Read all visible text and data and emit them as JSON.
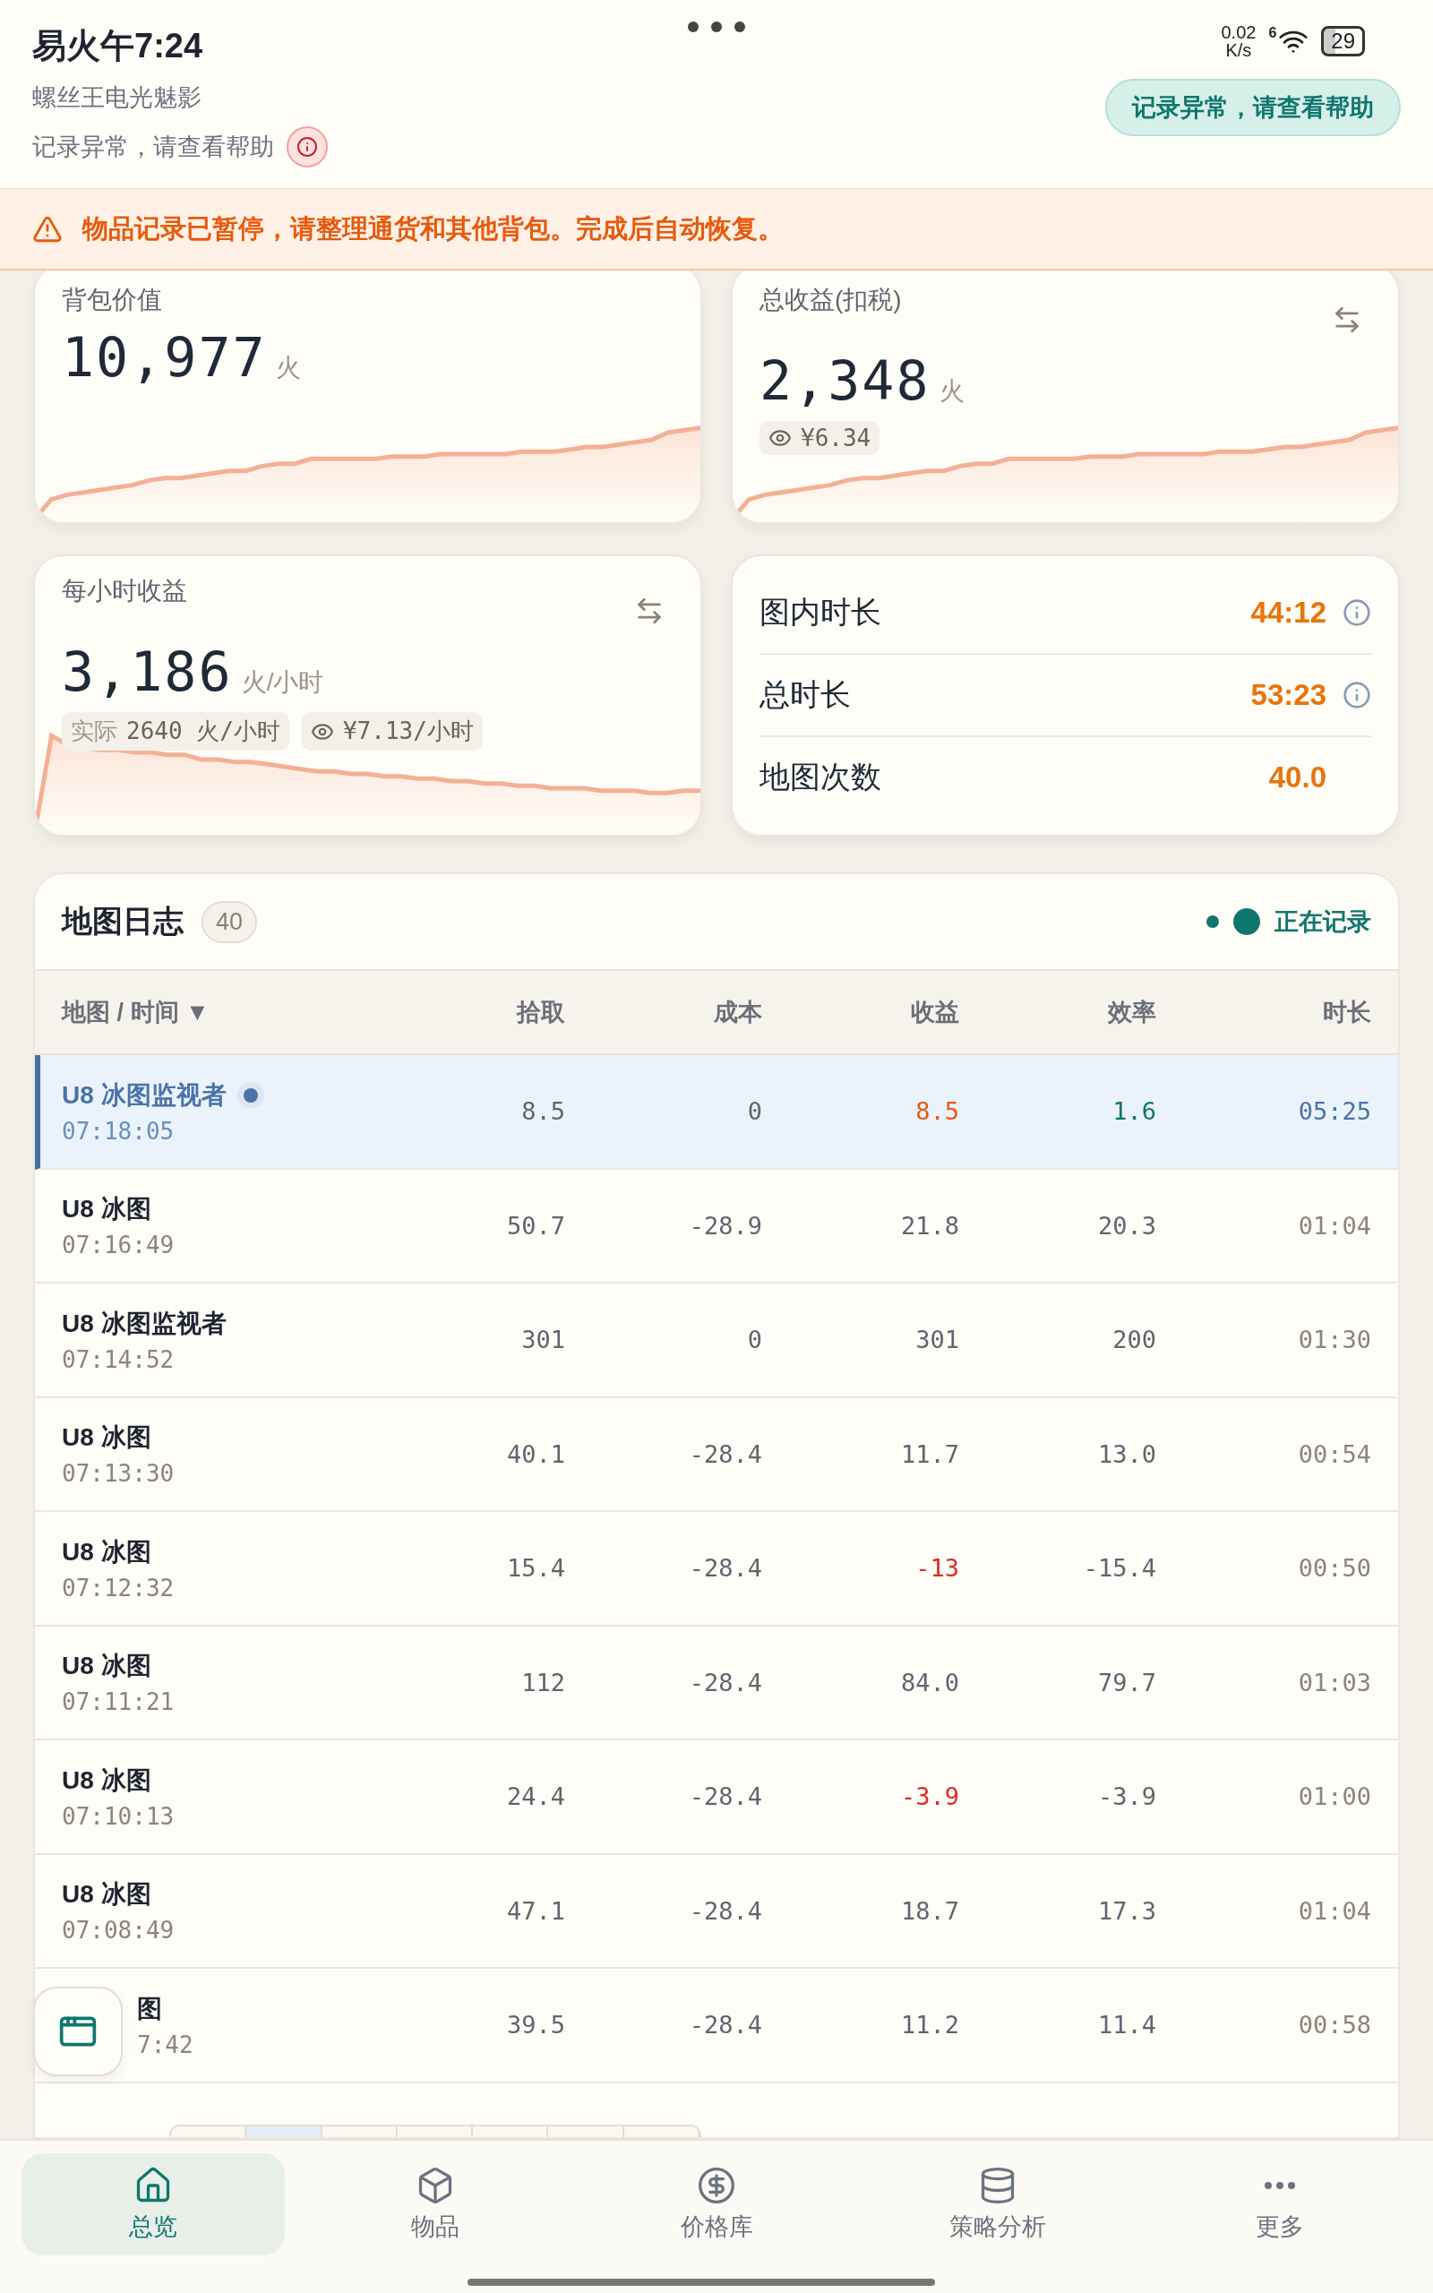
{
  "status_bar": {
    "time": "易火午7:24",
    "net_speed": "0.02",
    "net_unit": "K/s",
    "wifi_badge": "6",
    "battery": "29"
  },
  "header": {
    "subtitle": "螺丝王电光魅影",
    "warning": "记录异常，请查看帮助",
    "help_button": "记录异常，请查看帮助"
  },
  "banner": {
    "text": "物品记录已暂停，请整理通货和其他背包。完成后自动恢复。"
  },
  "cards": [
    {
      "kind": "value",
      "title": "背包价值",
      "value": "10,977",
      "unit": "火",
      "swap": false
    },
    {
      "kind": "value",
      "title": "总收益(扣税)",
      "value": "2,348",
      "unit": "火",
      "swap": true,
      "chips": [
        {
          "kind": "eye",
          "text": "¥6.34"
        }
      ]
    },
    {
      "kind": "value",
      "title": "每小时收益",
      "value": "3,186",
      "unit": "火/小时",
      "swap": true,
      "chips": [
        {
          "kind": "plain",
          "label": "实际",
          "text": "2640 火/小时"
        },
        {
          "kind": "eye",
          "text": "¥7.13/小时"
        }
      ]
    },
    {
      "kind": "stats",
      "rows": [
        {
          "label": "图内时长",
          "value": "44:12",
          "info": true
        },
        {
          "label": "总时长",
          "value": "53:23",
          "info": true
        },
        {
          "label": "地图次数",
          "value": "40.0",
          "info": false
        }
      ]
    }
  ],
  "map_log": {
    "title": "地图日志",
    "count": "40",
    "recording": true,
    "recording_label": "正在记录",
    "columns": [
      "地图 / 时间 ▼",
      "拾取",
      "成本",
      "收益",
      "效率",
      "时长"
    ],
    "rows": [
      {
        "map": "U8 冰图监视者",
        "time": "07:18:05",
        "pickup": "8.5",
        "cost": "0",
        "income": "8.5",
        "efficiency": "1.6",
        "duration": "05:25",
        "selected": true,
        "loss": false
      },
      {
        "map": "U8 冰图",
        "time": "07:16:49",
        "pickup": "50.7",
        "cost": "-28.9",
        "income": "21.8",
        "efficiency": "20.3",
        "duration": "01:04",
        "selected": false,
        "loss": false
      },
      {
        "map": "U8 冰图监视者",
        "time": "07:14:52",
        "pickup": "301",
        "cost": "0",
        "income": "301",
        "efficiency": "200",
        "duration": "01:30",
        "selected": false,
        "loss": false
      },
      {
        "map": "U8 冰图",
        "time": "07:13:30",
        "pickup": "40.1",
        "cost": "-28.4",
        "income": "11.7",
        "efficiency": "13.0",
        "duration": "00:54",
        "selected": false,
        "loss": false
      },
      {
        "map": "U8 冰图",
        "time": "07:12:32",
        "pickup": "15.4",
        "cost": "-28.4",
        "income": "-13",
        "efficiency": "-15.4",
        "duration": "00:50",
        "selected": false,
        "loss": true
      },
      {
        "map": "U8 冰图",
        "time": "07:11:21",
        "pickup": "112",
        "cost": "-28.4",
        "income": "84.0",
        "efficiency": "79.7",
        "duration": "01:03",
        "selected": false,
        "loss": false
      },
      {
        "map": "U8 冰图",
        "time": "07:10:13",
        "pickup": "24.4",
        "cost": "-28.4",
        "income": "-3.9",
        "efficiency": "-3.9",
        "duration": "01:00",
        "selected": false,
        "loss": true
      },
      {
        "map": "U8 冰图",
        "time": "07:08:49",
        "pickup": "47.1",
        "cost": "-28.4",
        "income": "18.7",
        "efficiency": "17.3",
        "duration": "01:04",
        "selected": false,
        "loss": false
      },
      {
        "map": "图",
        "time": "7:42",
        "pickup": "39.5",
        "cost": "-28.4",
        "income": "11.2",
        "efficiency": "11.4",
        "duration": "00:58",
        "selected": false,
        "loss": false
      }
    ]
  },
  "nav": [
    {
      "label": "总览",
      "selected": true
    },
    {
      "label": "物品",
      "selected": false
    },
    {
      "label": "价格库",
      "selected": false
    },
    {
      "label": "策略分析",
      "selected": false
    },
    {
      "label": "更多",
      "selected": false
    }
  ]
}
